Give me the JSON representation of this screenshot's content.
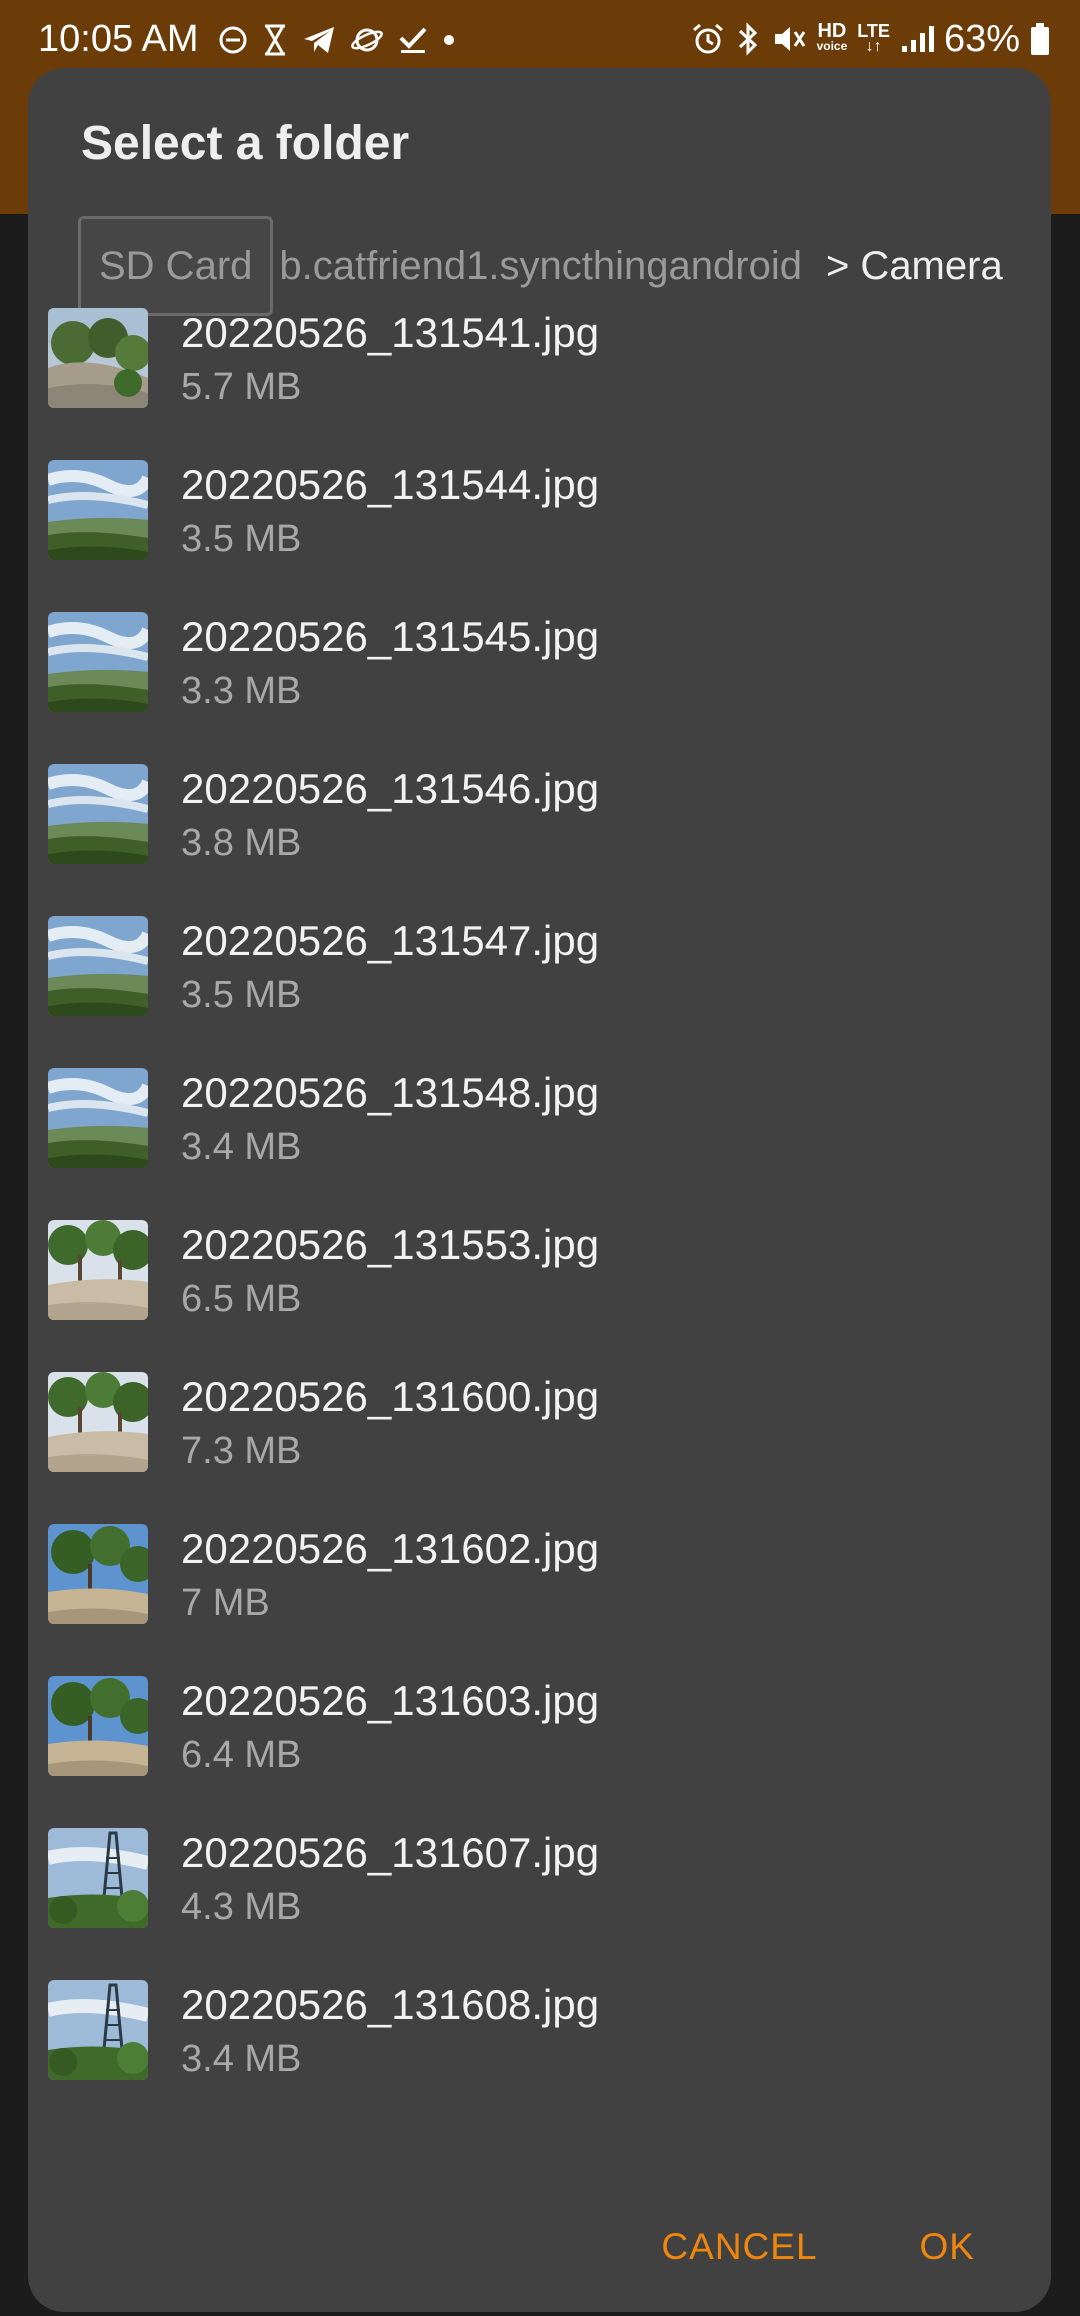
{
  "status_bar": {
    "time": "10:05 AM",
    "left_icons": [
      "do-not-disturb-icon",
      "hourglass-icon",
      "telegram-icon",
      "planet-icon",
      "checkmark-icon",
      "dot-icon"
    ],
    "right_icons": [
      "alarm-icon",
      "bluetooth-icon",
      "mute-icon",
      "hd-voice-icon",
      "lte-icon",
      "signal-icon",
      "battery-icon"
    ],
    "hd_label": "HD",
    "voice_label": "voice",
    "lte_label": "LTE",
    "battery": "63%"
  },
  "dialog": {
    "title": "Select a folder",
    "path": {
      "root": "SD Card",
      "middle": "b.catfriend1.syncthingandroid",
      "current": "> Camera"
    },
    "files": [
      {
        "name": "20220526_131541.jpg",
        "size": "5.7 MB",
        "thumb": "rock-trees"
      },
      {
        "name": "20220526_131544.jpg",
        "size": "3.5 MB",
        "thumb": "sky-hills"
      },
      {
        "name": "20220526_131545.jpg",
        "size": "3.3 MB",
        "thumb": "sky-hills"
      },
      {
        "name": "20220526_131546.jpg",
        "size": "3.8 MB",
        "thumb": "sky-hills"
      },
      {
        "name": "20220526_131547.jpg",
        "size": "3.5 MB",
        "thumb": "sky-hills"
      },
      {
        "name": "20220526_131548.jpg",
        "size": "3.4 MB",
        "thumb": "sky-hills"
      },
      {
        "name": "20220526_131553.jpg",
        "size": "6.5 MB",
        "thumb": "pine-rock"
      },
      {
        "name": "20220526_131600.jpg",
        "size": "7.3 MB",
        "thumb": "pine-rock"
      },
      {
        "name": "20220526_131602.jpg",
        "size": "7 MB",
        "thumb": "pine-sky"
      },
      {
        "name": "20220526_131603.jpg",
        "size": "6.4 MB",
        "thumb": "pine-sky"
      },
      {
        "name": "20220526_131607.jpg",
        "size": "4.3 MB",
        "thumb": "tower"
      },
      {
        "name": "20220526_131608.jpg",
        "size": "3.4 MB",
        "thumb": "tower"
      }
    ],
    "cancel_label": "CANCEL",
    "ok_label": "OK"
  },
  "colors": {
    "app_bar": "#6b3c08",
    "dialog_bg": "#414141",
    "accent": "#f0860c",
    "primary_text": "#f2f2f2",
    "secondary_text": "#a8a8a8"
  }
}
